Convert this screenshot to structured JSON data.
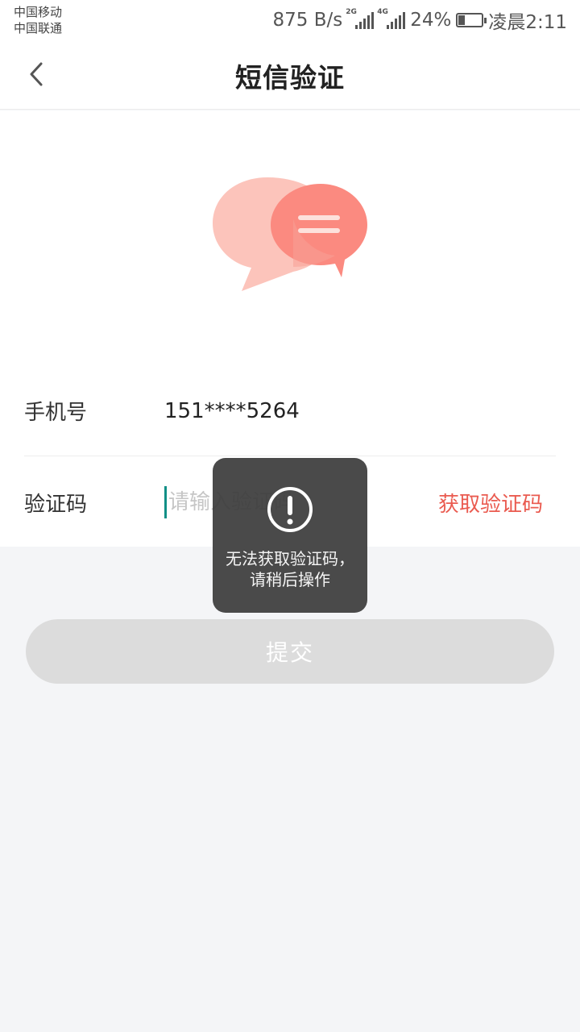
{
  "status_bar": {
    "carrier_1": "中国移动",
    "carrier_2": "中国联通",
    "network_speed": "875 B/s",
    "signal_1_tag": "2G",
    "signal_2_tag": "4G",
    "battery": "24%",
    "time": "凌晨2:11"
  },
  "navbar": {
    "title": "短信验证",
    "back_icon": "chevron-left-icon"
  },
  "form": {
    "phone_label": "手机号",
    "phone_value": "151****5264",
    "code_label": "验证码",
    "code_placeholder": "请输入验证码",
    "get_code_label": "获取验证码"
  },
  "submit_label": "提交",
  "toast": {
    "icon": "exclamation-circle-icon",
    "message": "无法获取验证码，请稍后操作"
  },
  "colors": {
    "accent": "#ea5b50",
    "cursor": "#0f8f86",
    "bubble_back": "#fcc4bb",
    "bubble_front": "#fb8a80",
    "button_disabled": "#dcdcdc"
  }
}
